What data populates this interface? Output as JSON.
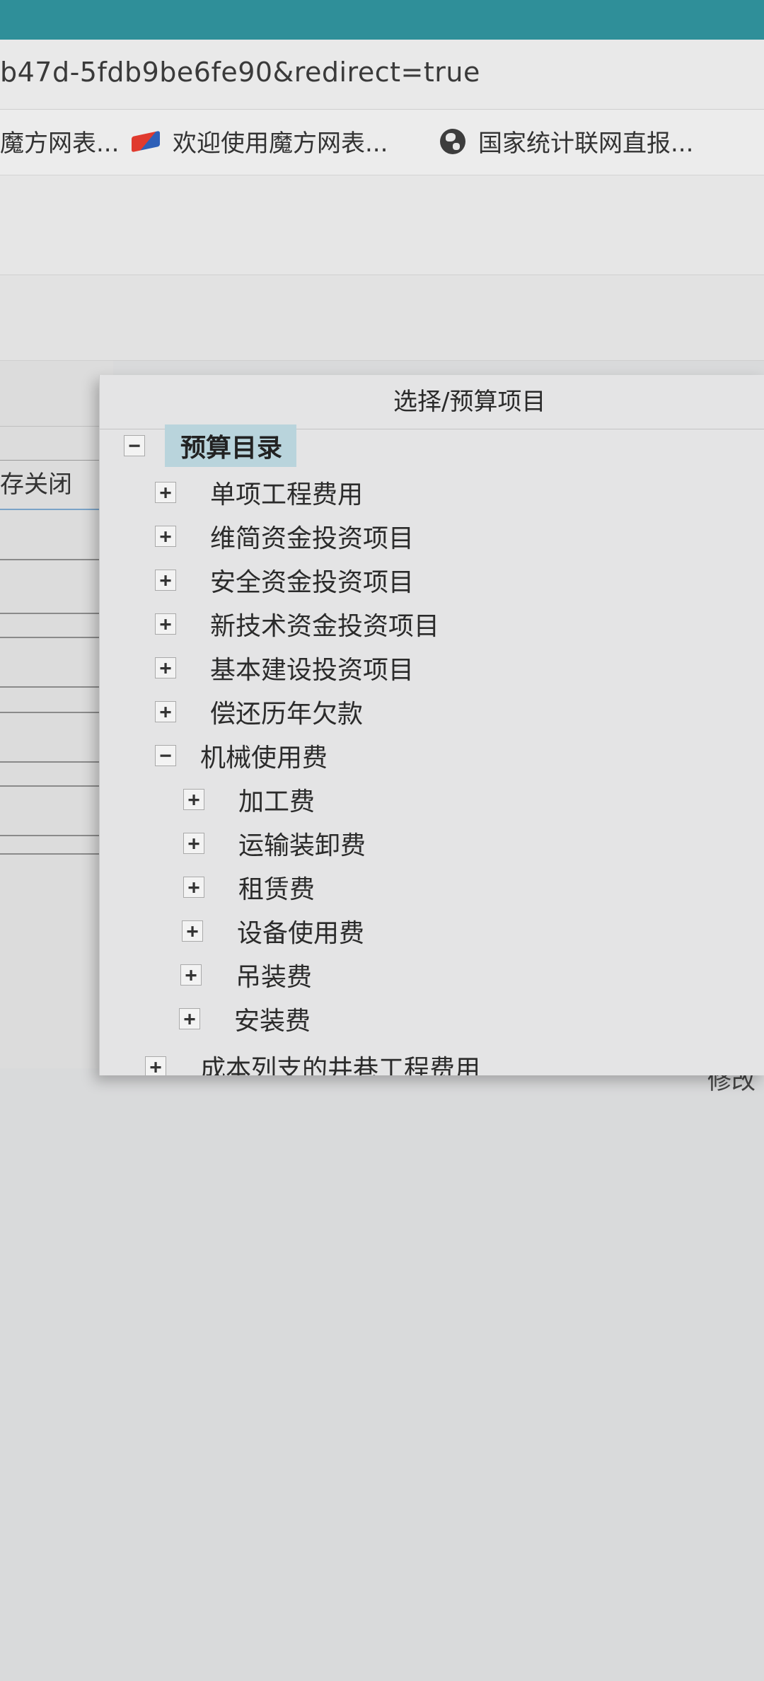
{
  "browser": {
    "url": "b47d-5fdb9be6fe90&redirect=true",
    "bookmarks": [
      {
        "label": "魔方网表...",
        "icon": "flag-icon"
      },
      {
        "label": "欢迎使用魔方网表...",
        "icon": "flag-icon"
      },
      {
        "label": "国家统计联网直报...",
        "icon": "globe-icon"
      }
    ]
  },
  "background_page": {
    "save_close_label": "存关闭",
    "partial_right_text": "修改"
  },
  "dialog": {
    "title": "选择/预算项目",
    "root": {
      "label": "预算目录",
      "toggle": "−"
    },
    "items": [
      {
        "label": "单项工程费用",
        "toggle": "+"
      },
      {
        "label": "维简资金投资项目",
        "toggle": "+"
      },
      {
        "label": "安全资金投资项目",
        "toggle": "+"
      },
      {
        "label": "新技术资金投资项目",
        "toggle": "+"
      },
      {
        "label": "基本建设投资项目",
        "toggle": "+"
      },
      {
        "label": "偿还历年欠款",
        "toggle": "+"
      },
      {
        "label": "机械使用费",
        "toggle": "−"
      },
      {
        "label": "加工费",
        "toggle": "+"
      },
      {
        "label": "运输装卸费",
        "toggle": "+"
      },
      {
        "label": "租赁费",
        "toggle": "+"
      },
      {
        "label": "设备使用费",
        "toggle": "+"
      },
      {
        "label": "吊装费",
        "toggle": "+"
      },
      {
        "label": "安装费",
        "toggle": "+"
      },
      {
        "label": "成本列支的井巷工程费用",
        "toggle": "+"
      }
    ]
  }
}
